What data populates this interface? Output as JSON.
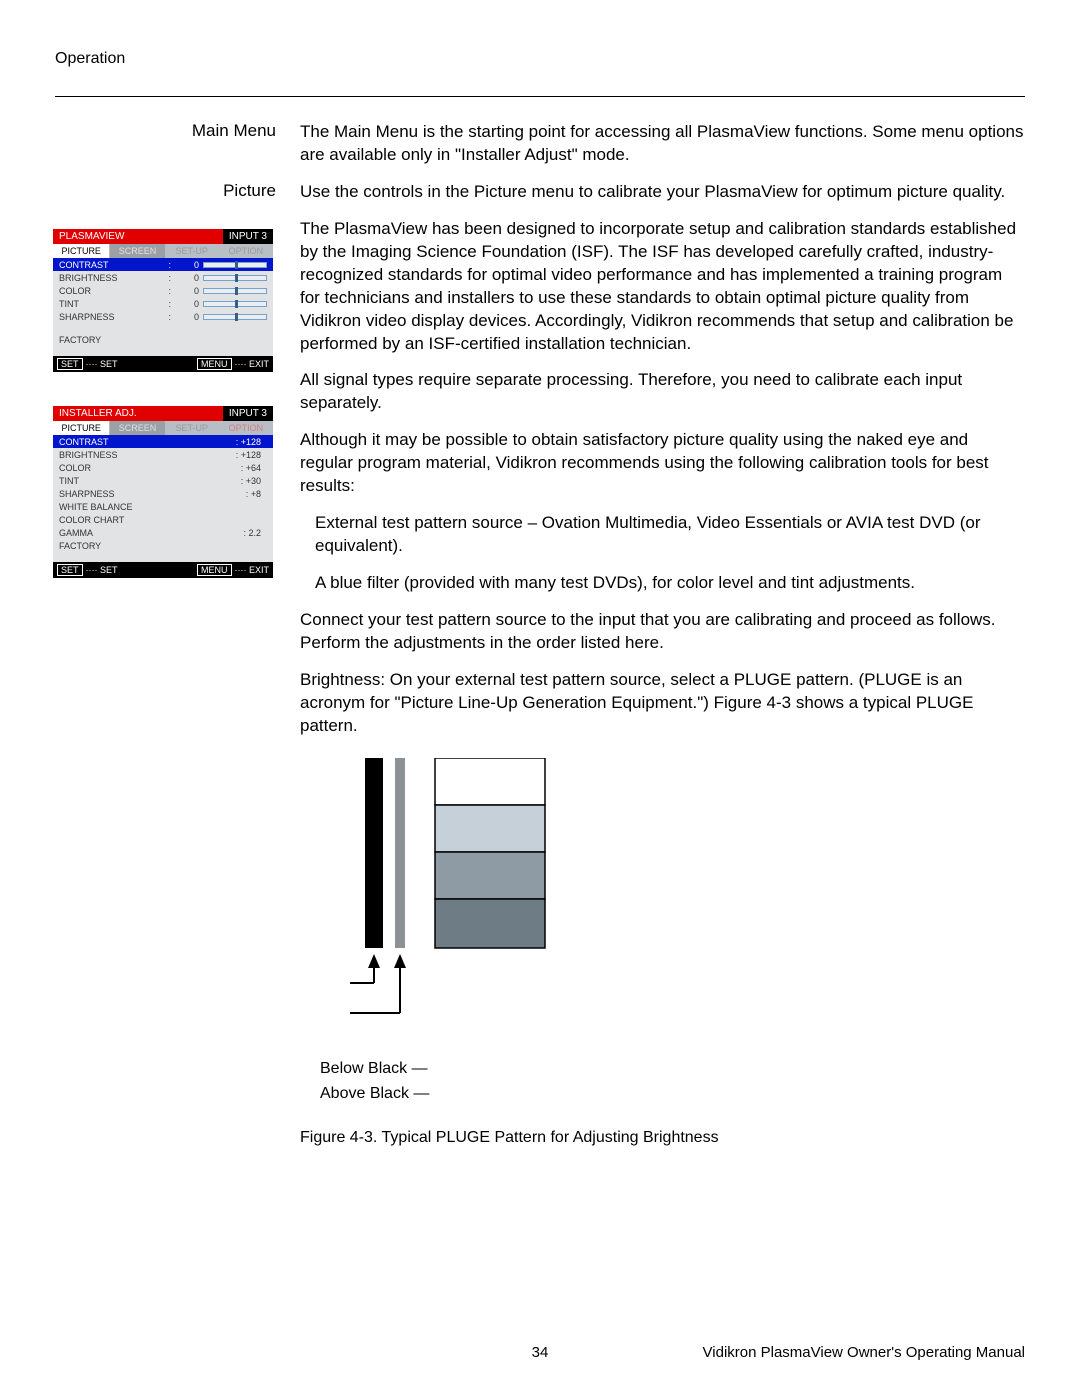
{
  "header": "Operation",
  "sections": {
    "mainmenu_label": "Main Menu",
    "mainmenu_text": "The Main Menu is the starting point for accessing all PlasmaView functions. Some menu options are available only in \"Installer Adjust\" mode.",
    "picture_label": "Picture",
    "picture_intro": "Use the controls in the Picture menu to calibrate your PlasmaView for optimum picture quality.",
    "p2": "The PlasmaView has been designed to incorporate setup and calibration standards established by the Imaging Science Foundation (ISF). The ISF has developed carefully crafted, industry-recognized standards for optimal video performance and has implemented a training program for technicians and installers to use these standards to obtain optimal picture quality from Vidikron video display devices. Accordingly, Vidikron recommends that setup and calibration be performed by an ISF-certified installation technician.",
    "p3": "All signal types require separate processing. Therefore, you need to calibrate each input separately.",
    "p4": "Although it may be possible to obtain satisfactory picture quality using the naked eye and regular program material, Vidikron recommends using the following calibration tools for best results:",
    "bullet1": "External test pattern source – Ovation Multimedia, Video Essentials or AVIA test DVD (or equivalent).",
    "bullet2": "A blue filter (provided with many test DVDs), for color level and tint adjustments.",
    "p5": "Connect your test pattern source to the input that you are calibrating and proceed as follows. Perform the adjustments in the order listed here.",
    "p6": "Brightness: On your external test pattern source, select a PLUGE pattern. (PLUGE is an acronym for \"Picture Line-Up Generation Equipment.\") Figure 4-3 shows a typical PLUGE pattern."
  },
  "osd1": {
    "title_left": "PLASMAVIEW",
    "title_right": "INPUT 3",
    "tabs": [
      "PICTURE",
      "SCREEN",
      "SET-UP",
      "OPTION"
    ],
    "rows": [
      {
        "label": "CONTRAST",
        "val": "0",
        "slider": true,
        "hl": true
      },
      {
        "label": "BRIGHTNESS",
        "val": "0",
        "slider": true
      },
      {
        "label": "COLOR",
        "val": "0",
        "slider": true
      },
      {
        "label": "TINT",
        "val": "0",
        "slider": true
      },
      {
        "label": "SHARPNESS",
        "val": "0",
        "slider": true
      }
    ],
    "factory": "FACTORY",
    "footer_set_box": "SET",
    "footer_set_text": "···· SET",
    "footer_menu_box": "MENU",
    "footer_menu_text": "···· EXIT"
  },
  "osd2": {
    "title_left": "INSTALLER ADJ.",
    "title_right": "INPUT 3",
    "tabs": [
      "PICTURE",
      "SCREEN",
      "SET-UP",
      "OPTION"
    ],
    "rows": [
      {
        "label": "CONTRAST",
        "val": "+128",
        "hl": true
      },
      {
        "label": "BRIGHTNESS",
        "val": "+128"
      },
      {
        "label": "COLOR",
        "val": "+64"
      },
      {
        "label": "TINT",
        "val": "+30"
      },
      {
        "label": "SHARPNESS",
        "val": "+8"
      },
      {
        "label": "WHITE BALANCE",
        "val": ""
      },
      {
        "label": "COLOR CHART",
        "val": ""
      },
      {
        "label": "GAMMA",
        "val": "2.2"
      },
      {
        "label": "FACTORY",
        "val": ""
      }
    ],
    "footer_set_box": "SET",
    "footer_set_text": "···· SET",
    "footer_menu_box": "MENU",
    "footer_menu_text": "···· EXIT"
  },
  "figure": {
    "below": "Below Black",
    "above": "Above Black",
    "caption": "Figure 4-3. Typical PLUGE Pattern for Adjusting Brightness"
  },
  "footer": {
    "page": "34",
    "doc": "Vidikron PlasmaView Owner's Operating Manual"
  }
}
